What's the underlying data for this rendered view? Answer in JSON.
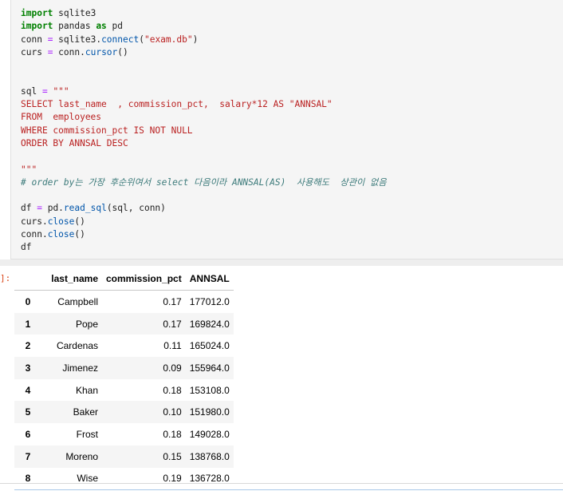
{
  "code_cell": {
    "lines": {
      "l1": {
        "kw": "import",
        "rest": " sqlite3"
      },
      "l2": {
        "kw1": "import",
        "mid": " pandas ",
        "kw2": "as",
        "rest": " pd"
      },
      "l3": {
        "a": "conn ",
        "op": "=",
        "b": " sqlite3.",
        "fn": "connect",
        "c": "(",
        "str": "\"exam.db\"",
        "d": ")"
      },
      "l4": {
        "a": "curs ",
        "op": "=",
        "b": " conn.",
        "fn": "cursor",
        "c": "()"
      },
      "l7": {
        "a": "sql ",
        "op": "=",
        "str": " \"\"\""
      },
      "l8": "SELECT last_name  , commission_pct,  salary*12 AS \"ANNSAL\"",
      "l9": "FROM  employees",
      "l10": "WHERE commission_pct IS NOT NULL",
      "l11": "ORDER BY ANNSAL DESC",
      "l13": "\"\"\"",
      "l14": "# order by는 가장 후순위여서 select 다음이라 ANNSAL(AS)  사용해도  상관이 없음",
      "l16": {
        "a": "df ",
        "op": "=",
        "b": " pd.",
        "fn": "read_sql",
        "c": "(sql, conn)"
      },
      "l17": {
        "a": "curs.",
        "fn": "close",
        "c": "()"
      },
      "l18": {
        "a": "conn.",
        "fn": "close",
        "c": "()"
      },
      "l19": "df"
    }
  },
  "output": {
    "prompt": "]:",
    "columns": [
      "last_name",
      "commission_pct",
      "ANNSAL"
    ],
    "rows": [
      {
        "index": "0",
        "last_name": "Campbell",
        "commission_pct": "0.17",
        "ANNSAL": "177012.0"
      },
      {
        "index": "1",
        "last_name": "Pope",
        "commission_pct": "0.17",
        "ANNSAL": "169824.0"
      },
      {
        "index": "2",
        "last_name": "Cardenas",
        "commission_pct": "0.11",
        "ANNSAL": "165024.0"
      },
      {
        "index": "3",
        "last_name": "Jimenez",
        "commission_pct": "0.09",
        "ANNSAL": "155964.0"
      },
      {
        "index": "4",
        "last_name": "Khan",
        "commission_pct": "0.18",
        "ANNSAL": "153108.0"
      },
      {
        "index": "5",
        "last_name": "Baker",
        "commission_pct": "0.10",
        "ANNSAL": "151980.0"
      },
      {
        "index": "6",
        "last_name": "Frost",
        "commission_pct": "0.18",
        "ANNSAL": "149028.0"
      },
      {
        "index": "7",
        "last_name": "Moreno",
        "commission_pct": "0.15",
        "ANNSAL": "138768.0"
      },
      {
        "index": "8",
        "last_name": "Wise",
        "commission_pct": "0.19",
        "ANNSAL": "136728.0"
      }
    ]
  },
  "colors": {
    "keyword": "#008000",
    "function": "#0055aa",
    "string": "#ba2121",
    "comment": "#3d7b7b",
    "prompt": "#d84315",
    "cell_background": "#f5f5f5"
  }
}
